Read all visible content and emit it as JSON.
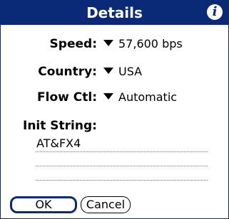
{
  "dialog": {
    "title": "Details",
    "info_icon": "info-icon",
    "fields": {
      "speed": {
        "label": "Speed:",
        "value": "57,600 bps"
      },
      "country": {
        "label": "Country:",
        "value": "USA"
      },
      "flow_ctl": {
        "label": "Flow Ctl:",
        "value": "Automatic"
      }
    },
    "init_string": {
      "label": "Init String:",
      "value": "AT&FX4"
    },
    "buttons": {
      "ok": "OK",
      "cancel": "Cancel"
    }
  },
  "colors": {
    "titlebar": "#0a2a78",
    "background": "#ffffff"
  }
}
